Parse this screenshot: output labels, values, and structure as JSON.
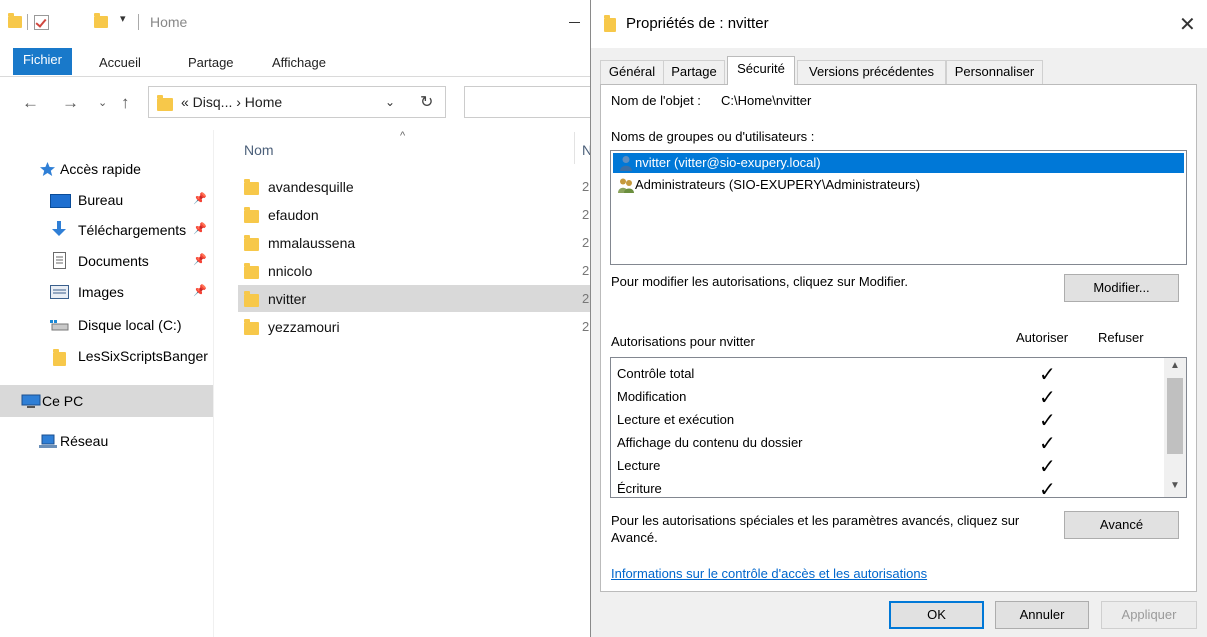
{
  "explorer": {
    "quick_access_title": "Home",
    "ribbon_tabs": [
      "Fichier",
      "Accueil",
      "Partage",
      "Affichage"
    ],
    "address_path": "« Disq... › Home",
    "nav_back_icon": "arrow-left-icon",
    "nav_items": [
      {
        "label": "Accès rapide",
        "icon": "star-icon"
      },
      {
        "label": "Bureau",
        "icon": "desktop-icon"
      },
      {
        "label": "Téléchargements",
        "icon": "download-icon"
      },
      {
        "label": "Documents",
        "icon": "document-icon"
      },
      {
        "label": "Images",
        "icon": "image-icon"
      },
      {
        "label": "Disque local (C:)",
        "icon": "drive-icon"
      },
      {
        "label": "LesSixScriptsBanger",
        "icon": "folder-icon"
      },
      {
        "label": "Ce PC",
        "icon": "pc-icon"
      },
      {
        "label": "Réseau",
        "icon": "network-icon"
      }
    ],
    "column_name": "Nom",
    "column_next": "N",
    "files": [
      {
        "name": "avandesquille",
        "date": "2"
      },
      {
        "name": "efaudon",
        "date": "2"
      },
      {
        "name": "mmalaussena",
        "date": "2"
      },
      {
        "name": "nnicolo",
        "date": "2"
      },
      {
        "name": "nvitter",
        "date": "2"
      },
      {
        "name": "yezzamouri",
        "date": "2"
      }
    ],
    "selected_file": "nvitter"
  },
  "dialog": {
    "title": "Propriétés de : nvitter",
    "tabs": [
      "Général",
      "Partage",
      "Sécurité",
      "Versions précédentes",
      "Personnaliser"
    ],
    "active_tab": "Sécurité",
    "object_name_label": "Nom de l'objet :",
    "object_name_value": "C:\\Home\\nvitter",
    "groups_label": "Noms de groupes ou d'utilisateurs :",
    "users": [
      {
        "label": "nvitter (vitter@sio-exupery.local)",
        "selected": true
      },
      {
        "label": "Administrateurs (SIO-EXUPERY\\Administrateurs)",
        "selected": false
      }
    ],
    "modify_hint": "Pour modifier les autorisations, cliquez sur Modifier.",
    "modify_button": "Modifier...",
    "permissions_label": "Autorisations pour nvitter",
    "allow_header": "Autoriser",
    "deny_header": "Refuser",
    "permissions": [
      {
        "name": "Contrôle total",
        "allow": "✓",
        "deny": ""
      },
      {
        "name": "Modification",
        "allow": "✓",
        "deny": ""
      },
      {
        "name": "Lecture et exécution",
        "allow": "✓",
        "deny": ""
      },
      {
        "name": "Affichage du contenu du dossier",
        "allow": "✓",
        "deny": ""
      },
      {
        "name": "Lecture",
        "allow": "✓",
        "deny": ""
      },
      {
        "name": "Écriture",
        "allow": "✓",
        "deny": ""
      }
    ],
    "advanced_hint_line1": "Pour les autorisations spéciales et les paramètres avancés, cliquez sur",
    "advanced_hint_line2": "Avancé.",
    "advanced_button": "Avancé",
    "info_link": "Informations sur le contrôle d'accès et les autorisations",
    "ok_button": "OK",
    "cancel_button": "Annuler",
    "apply_button": "Appliquer"
  },
  "colors": {
    "accent": "#0078d7",
    "ribbon_file_tab": "#1979ca",
    "folder": "#f7c84a",
    "selection_gray": "#d9d9d9",
    "link": "#0066cc"
  }
}
